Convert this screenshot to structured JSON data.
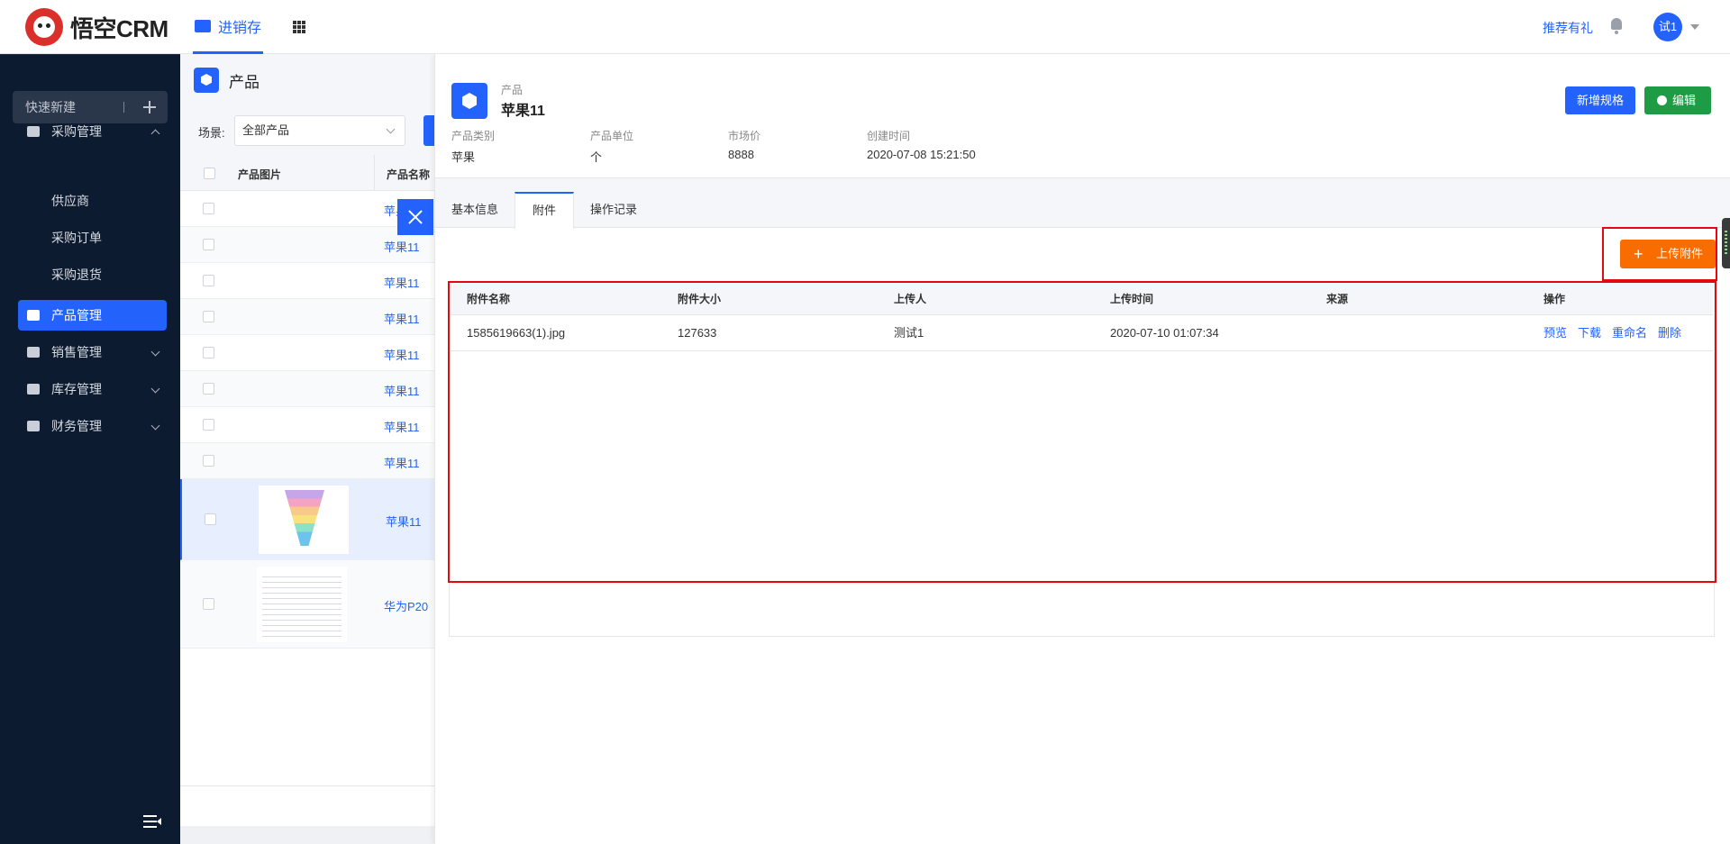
{
  "header": {
    "logo_text": "悟空CRM",
    "module_tab": "进销存",
    "recommend": "推荐有礼",
    "user_avatar": "试1"
  },
  "sidebar": {
    "quick_new": "快速新建",
    "menu": [
      {
        "label": "采购管理",
        "expanded": true
      },
      {
        "label": "产品管理",
        "active": true
      },
      {
        "label": "销售管理"
      },
      {
        "label": "库存管理"
      },
      {
        "label": "财务管理"
      }
    ],
    "purchase_sub": [
      "供应商",
      "采购订单",
      "采购退货"
    ]
  },
  "list": {
    "title": "产品",
    "scene_label": "场景:",
    "scene_value": "全部产品",
    "columns": [
      "产品图片",
      "产品名称"
    ],
    "rows": [
      {
        "name": "苹果11",
        "thumb": ""
      },
      {
        "name": "苹果11",
        "thumb": ""
      },
      {
        "name": "苹果11",
        "thumb": ""
      },
      {
        "name": "苹果11",
        "thumb": ""
      },
      {
        "name": "苹果11",
        "thumb": ""
      },
      {
        "name": "苹果11",
        "thumb": ""
      },
      {
        "name": "苹果11",
        "thumb": ""
      },
      {
        "name": "苹果11",
        "thumb": ""
      },
      {
        "name": "苹果11",
        "thumb": "funnel"
      },
      {
        "name": "华为P20",
        "thumb": "doc"
      }
    ]
  },
  "detail": {
    "type_label": "产品",
    "name": "苹果11",
    "btn_add_spec": "新增规格",
    "btn_edit": "编辑",
    "meta": [
      {
        "key": "产品类别",
        "value": "苹果"
      },
      {
        "key": "产品单位",
        "value": "个"
      },
      {
        "key": "市场价",
        "value": "8888"
      },
      {
        "key": "创建时间",
        "value": "2020-07-08 15:21:50"
      }
    ],
    "tabs": [
      "基本信息",
      "附件",
      "操作记录"
    ],
    "active_tab": "附件",
    "upload_btn": "上传附件"
  },
  "attachments": {
    "columns": [
      "附件名称",
      "附件大小",
      "上传人",
      "上传时间",
      "来源",
      "操作"
    ],
    "rows": [
      {
        "name": "1585619663(1).jpg",
        "size": "127633",
        "uploader": "测试1",
        "time": "2020-07-10 01:07:34",
        "source": "",
        "actions": [
          "预览",
          "下载",
          "重命名",
          "删除"
        ]
      }
    ]
  },
  "colors": {
    "primary": "#2362fb",
    "success": "#1e9b45",
    "orange": "#f96d00",
    "highlight": "#e4090f",
    "sidebar": "#0d1b31"
  }
}
